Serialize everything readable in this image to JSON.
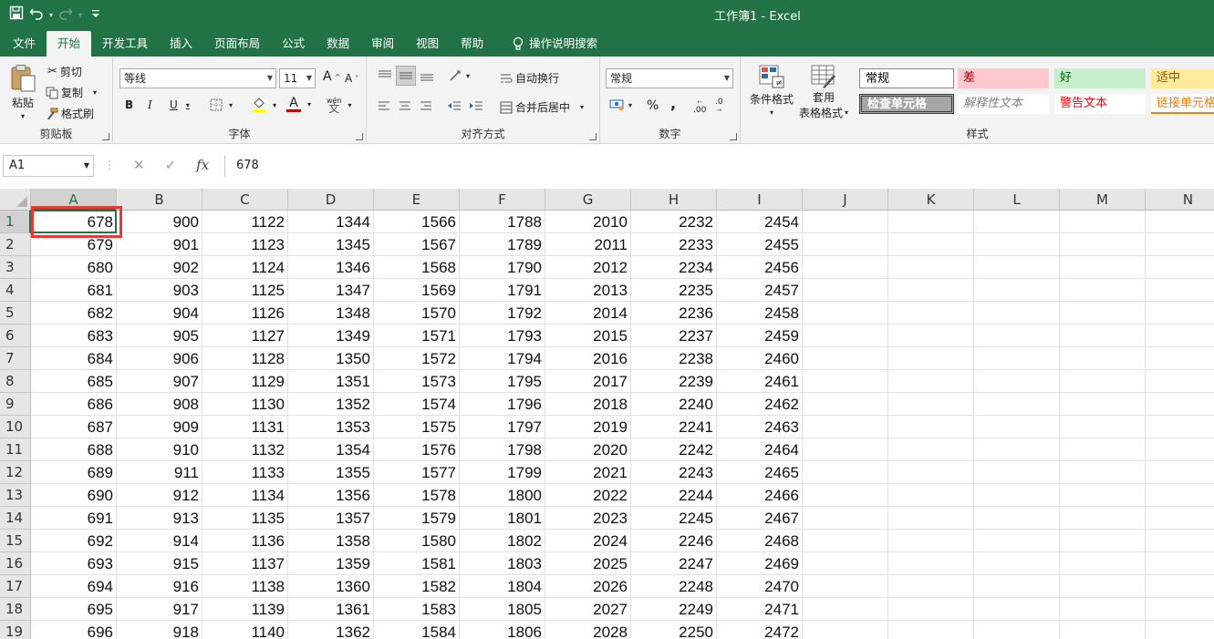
{
  "app": {
    "title": "工作簿1  -  Excel"
  },
  "qat": {
    "save": "save-icon",
    "undo": "undo-icon",
    "redo": "redo-icon",
    "customize": "▾"
  },
  "tabs": [
    "文件",
    "开始",
    "开发工具",
    "插入",
    "页面布局",
    "公式",
    "数据",
    "审阅",
    "视图",
    "帮助"
  ],
  "tell_me": "操作说明搜索",
  "ribbon": {
    "clipboard": {
      "label": "剪贴板",
      "paste": "粘贴",
      "cut": "剪切",
      "copy": "复制",
      "format_painter": "格式刷"
    },
    "font": {
      "label": "字体",
      "name": "等线",
      "size": "11",
      "bold": "B",
      "italic": "I",
      "underline": "U",
      "grow": "A",
      "shrink": "A",
      "font_color_icon": "A",
      "phonetic": "wén"
    },
    "alignment": {
      "label": "对齐方式",
      "wrap": "自动换行",
      "merge": "合并后居中"
    },
    "number": {
      "label": "数字",
      "format": "常规",
      "percent": "%",
      "comma": ",",
      "inc_decimal": ".00",
      "dec_decimal": ".0"
    },
    "styles": {
      "label": "样式",
      "conditional": "条件格式",
      "table_format_1": "套用",
      "table_format_2": "表格格式",
      "cells": [
        {
          "text": "常规",
          "bg": "#ffffff",
          "color": "#000000"
        },
        {
          "text": "差",
          "bg": "#ffc7ce",
          "color": "#9c0006"
        },
        {
          "text": "好",
          "bg": "#c6efce",
          "color": "#006100"
        },
        {
          "text": "适中",
          "bg": "#ffeb9c",
          "color": "#9c5700"
        },
        {
          "text": "检查单元格",
          "bg": "#a5a5a5",
          "color": "#ffffff"
        },
        {
          "text": "解释性文本",
          "bg": "#ffffff",
          "color": "#7f7f7f"
        },
        {
          "text": "警告文本",
          "bg": "#ffffff",
          "color": "#ff0000"
        },
        {
          "text": "链接单元格",
          "bg": "#ffffff",
          "color": "#fa7d00"
        }
      ]
    }
  },
  "formula_bar": {
    "name_box": "A1",
    "cancel": "✕",
    "enter": "✓",
    "fx": "fx",
    "value": "678"
  },
  "sheet": {
    "columns": [
      "A",
      "B",
      "C",
      "D",
      "E",
      "F",
      "G",
      "H",
      "I",
      "J",
      "K",
      "L",
      "M",
      "N"
    ],
    "rows": [
      [
        678,
        900,
        1122,
        1344,
        1566,
        1788,
        2010,
        2232,
        2454
      ],
      [
        679,
        901,
        1123,
        1345,
        1567,
        1789,
        2011,
        2233,
        2455
      ],
      [
        680,
        902,
        1124,
        1346,
        1568,
        1790,
        2012,
        2234,
        2456
      ],
      [
        681,
        903,
        1125,
        1347,
        1569,
        1791,
        2013,
        2235,
        2457
      ],
      [
        682,
        904,
        1126,
        1348,
        1570,
        1792,
        2014,
        2236,
        2458
      ],
      [
        683,
        905,
        1127,
        1349,
        1571,
        1793,
        2015,
        2237,
        2459
      ],
      [
        684,
        906,
        1128,
        1350,
        1572,
        1794,
        2016,
        2238,
        2460
      ],
      [
        685,
        907,
        1129,
        1351,
        1573,
        1795,
        2017,
        2239,
        2461
      ],
      [
        686,
        908,
        1130,
        1352,
        1574,
        1796,
        2018,
        2240,
        2462
      ],
      [
        687,
        909,
        1131,
        1353,
        1575,
        1797,
        2019,
        2241,
        2463
      ],
      [
        688,
        910,
        1132,
        1354,
        1576,
        1798,
        2020,
        2242,
        2464
      ],
      [
        689,
        911,
        1133,
        1355,
        1577,
        1799,
        2021,
        2243,
        2465
      ],
      [
        690,
        912,
        1134,
        1356,
        1578,
        1800,
        2022,
        2244,
        2466
      ],
      [
        691,
        913,
        1135,
        1357,
        1579,
        1801,
        2023,
        2245,
        2467
      ],
      [
        692,
        914,
        1136,
        1358,
        1580,
        1802,
        2024,
        2246,
        2468
      ],
      [
        693,
        915,
        1137,
        1359,
        1581,
        1803,
        2025,
        2247,
        2469
      ],
      [
        694,
        916,
        1138,
        1360,
        1582,
        1804,
        2026,
        2248,
        2470
      ],
      [
        695,
        917,
        1139,
        1361,
        1583,
        1805,
        2027,
        2249,
        2471
      ],
      [
        696,
        918,
        1140,
        1362,
        1584,
        1806,
        2028,
        2250,
        2472
      ]
    ],
    "active_cell": "A1",
    "highlight_color": "#e53935"
  }
}
